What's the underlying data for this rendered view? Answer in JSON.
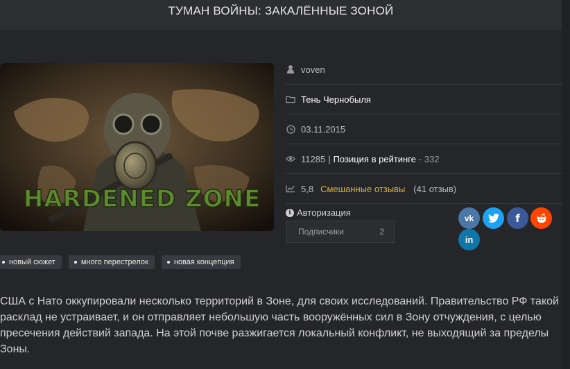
{
  "header": {
    "title": "ТУМАН ВОЙНЫ: ЗАКАЛЁННЫЕ ЗОНОЙ"
  },
  "cover": {
    "logo_text": "HARDENED ZONE"
  },
  "meta": {
    "author": "voven",
    "game": "Тень Чернобыля",
    "date": "03.11.2015",
    "views": "11285",
    "separator": "|",
    "rating_label": "Позиция в рейтинге",
    "rating_value": "- 332",
    "score": "5,8",
    "reviews_label": "Смешанные отзывы",
    "reviews_count": "(41 отзыв)"
  },
  "auth": {
    "label": "Авторизация"
  },
  "subscribers": {
    "label": "Подписчики",
    "count": "2"
  },
  "share": {
    "buttons": [
      {
        "name": "vk",
        "glyph": "vk",
        "color": "#4a76a8"
      },
      {
        "name": "twitter",
        "glyph": "t",
        "color": "#1da1f2"
      },
      {
        "name": "facebook",
        "glyph": "f",
        "color": "#3b5998"
      },
      {
        "name": "reddit",
        "glyph": "r",
        "color": "#ff4500"
      },
      {
        "name": "linkedin",
        "glyph": "in",
        "color": "#0e76a8"
      }
    ]
  },
  "tags": [
    "новый сюжет",
    "много перестрелок",
    "новая концепция"
  ],
  "description": "США с Нато оккупировали несколько территорий в Зоне, для своих исследований. Правительство РФ такой расклад не устраивает, и он отправляет небольшую часть вооружённых сил в Зону отчуждения, с целью пресечения действий запада. На этой почве разжигается локальный конфликт, не выходящий за пределы Зоны."
}
